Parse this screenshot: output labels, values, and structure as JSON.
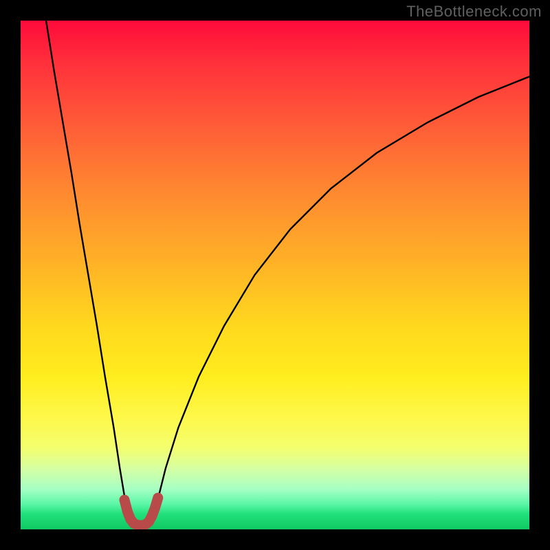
{
  "watermark": "TheBottleneck.com",
  "colors": {
    "background": "#000000",
    "curve": "#000000",
    "marker": "#b94a4a",
    "watermark_text": "#606060",
    "gradient_stops": [
      "#ff0a3a",
      "#ff2f3b",
      "#ff5a38",
      "#ff8a30",
      "#ffb326",
      "#ffd81e",
      "#ffed1e",
      "#fef84a",
      "#f4ff6e",
      "#d6ffa2",
      "#a8ffc4",
      "#5cf7a8",
      "#21e07a",
      "#10c862"
    ]
  },
  "chart_data": {
    "type": "line",
    "title": "",
    "xlabel": "",
    "ylabel": "",
    "xlim": [
      0,
      1
    ],
    "ylim": [
      0,
      1
    ],
    "series": [
      {
        "name": "left-branch",
        "x": [
          0.05,
          0.066,
          0.083,
          0.1,
          0.116,
          0.133,
          0.15,
          0.166,
          0.183,
          0.195,
          0.205,
          0.215
        ],
        "y": [
          1.0,
          0.9,
          0.8,
          0.7,
          0.6,
          0.5,
          0.4,
          0.3,
          0.2,
          0.12,
          0.06,
          0.02
        ]
      },
      {
        "name": "right-branch",
        "x": [
          0.26,
          0.27,
          0.285,
          0.31,
          0.35,
          0.4,
          0.46,
          0.53,
          0.61,
          0.7,
          0.8,
          0.9,
          1.0
        ],
        "y": [
          0.02,
          0.06,
          0.12,
          0.2,
          0.3,
          0.4,
          0.5,
          0.59,
          0.67,
          0.74,
          0.8,
          0.85,
          0.89
        ]
      },
      {
        "name": "valley-marker",
        "x": [
          0.204,
          0.21,
          0.216,
          0.222,
          0.228,
          0.234,
          0.24,
          0.246,
          0.252,
          0.258,
          0.264,
          0.27
        ],
        "y": [
          0.058,
          0.035,
          0.02,
          0.012,
          0.009,
          0.008,
          0.008,
          0.01,
          0.015,
          0.026,
          0.042,
          0.062
        ]
      }
    ]
  }
}
